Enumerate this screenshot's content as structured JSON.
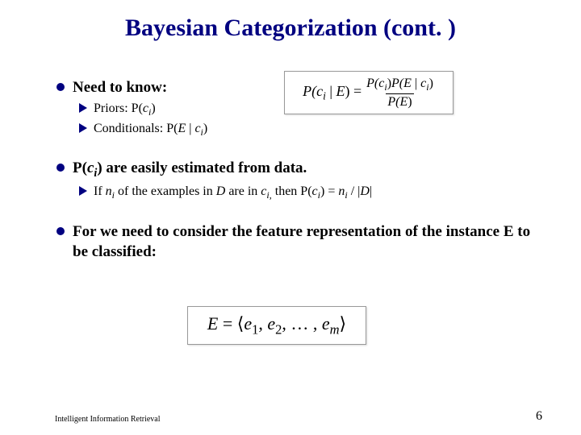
{
  "title": "Bayesian Categorization (cont. )",
  "bullets": {
    "b1": "Need to know:",
    "b1a_pre": "Priors: P(",
    "b1a_c": "c",
    "b1a_i": "i",
    "b1a_post": ")",
    "b1b_pre": "Conditionals: P(",
    "b1b_E": "E",
    "b1b_mid": " | ",
    "b1b_c": "c",
    "b1b_i": "i",
    "b1b_post": ")",
    "b2_pre": "P(",
    "b2_c": "c",
    "b2_i": "i",
    "b2_post": ") are easily estimated from data.",
    "b2a_pre": "If ",
    "b2a_n": "n",
    "b2a_ni": "i",
    "b2a_mid1": " of the examples in ",
    "b2a_D": "D",
    "b2a_mid2": " are in ",
    "b2a_c": "c",
    "b2a_ci": "i,",
    "b2a_mid3": " then  P(",
    "b2a_c2": "c",
    "b2a_ci2": "i",
    "b2a_mid4": ") =  ",
    "b2a_n2": "n",
    "b2a_ni2": "i",
    "b2a_mid5": " / |",
    "b2a_D2": "D",
    "b2a_end": "|",
    "b3": "For we need to consider the feature representation of the instance E to be classified:"
  },
  "bayes": {
    "lhs_pre": "P(",
    "lhs_c": "c",
    "lhs_i": "i",
    "lhs_mid": " | ",
    "lhs_E": "E",
    "lhs_post": ") = ",
    "num_p1_pre": "P(",
    "num_p1_c": "c",
    "num_p1_i": "i",
    "num_p1_post": ")",
    "num_p2_pre": "P(",
    "num_p2_E": "E",
    "num_p2_mid": " | ",
    "num_p2_c": "c",
    "num_p2_i": "i",
    "num_p2_post": ")",
    "den_pre": "P(",
    "den_E": "E",
    "den_post": ")"
  },
  "evec": {
    "E": "E",
    "eq": " = ⟨",
    "e": "e",
    "s1": "1",
    "c1": ", ",
    "s2": "2",
    "c2": ", … , ",
    "sm": "m",
    "close": "⟩"
  },
  "footer": {
    "left": "Intelligent Information Retrieval",
    "right": "6"
  }
}
